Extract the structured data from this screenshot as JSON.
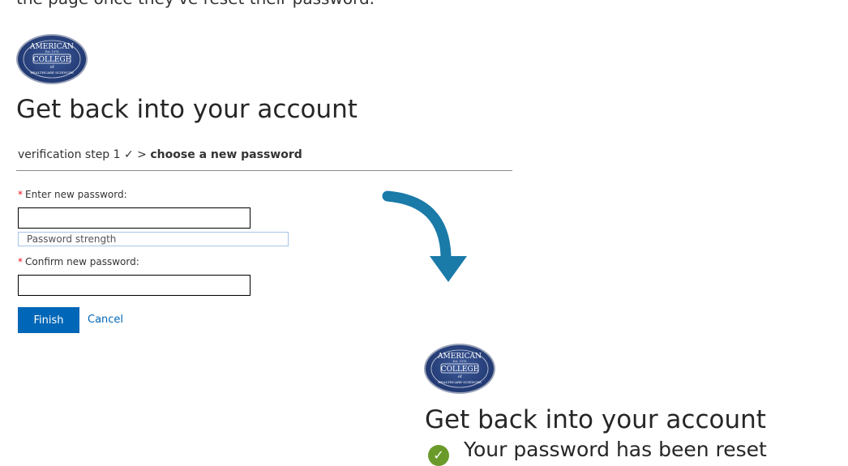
{
  "top_caption": "the page once they've reset their password.",
  "logo": {
    "line1": "AMERICAN",
    "line2": "COLLEGE",
    "line3": "of",
    "line4": "HEALTHCARE SCIENCES",
    "est": "Est. 1978"
  },
  "heading": "Get back into your account",
  "steps": {
    "prefix": "verification step 1 ✓ > ",
    "current": "choose a new password"
  },
  "form": {
    "required_mark": "*",
    "new_password_label": "Enter new password:",
    "new_password_value": "",
    "strength_label": "Password strength",
    "confirm_password_label": "Confirm new password:",
    "confirm_password_value": ""
  },
  "buttons": {
    "finish": "Finish",
    "cancel": "Cancel"
  },
  "result": {
    "heading": "Get back into your account",
    "message": "Your password has been reset",
    "check_icon": "✓"
  },
  "colors": {
    "accent": "#0067b8",
    "arrow": "#1a7aa8",
    "success": "#6a9b2a",
    "required": "#e81123"
  }
}
